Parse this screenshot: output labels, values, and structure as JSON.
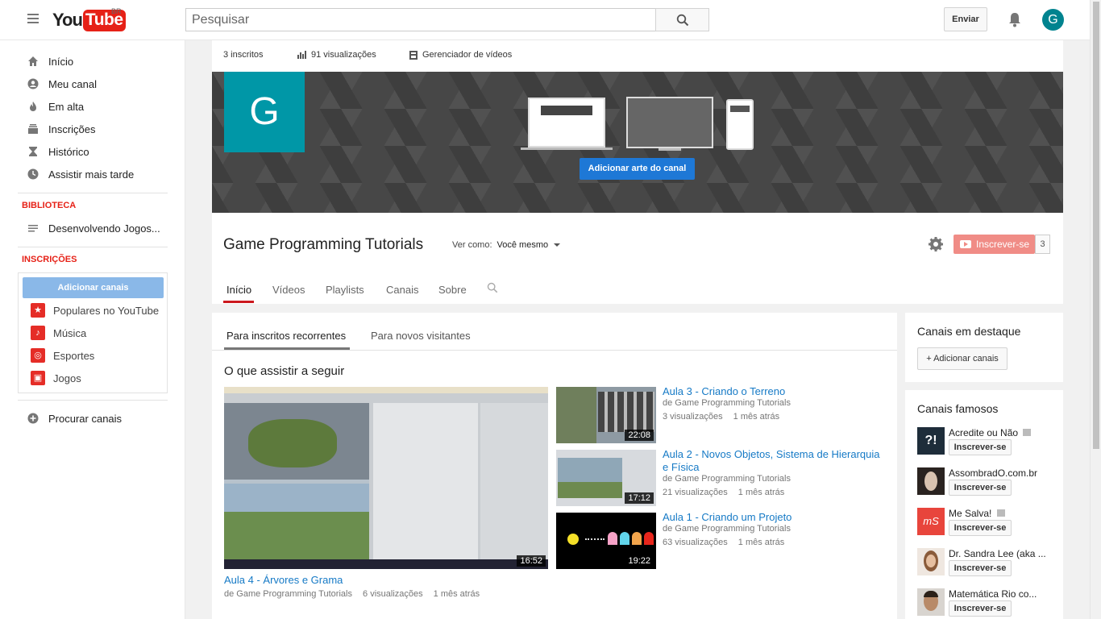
{
  "topbar": {
    "logo_you": "You",
    "logo_tube": "Tube",
    "region": "BR",
    "search_placeholder": "Pesquisar",
    "upload_label": "Enviar",
    "avatar_letter": "G"
  },
  "sidebar": {
    "nav": [
      {
        "label": "Início",
        "icon": "home-icon"
      },
      {
        "label": "Meu canal",
        "icon": "account-icon"
      },
      {
        "label": "Em alta",
        "icon": "flame-icon"
      },
      {
        "label": "Inscrições",
        "icon": "subscriptions-icon"
      },
      {
        "label": "Histórico",
        "icon": "hourglass-icon"
      },
      {
        "label": "Assistir mais tarde",
        "icon": "clock-icon"
      }
    ],
    "library_title": "BIBLIOTECA",
    "library_items": [
      {
        "label": "Desenvolvendo Jogos...",
        "icon": "playlist-icon"
      }
    ],
    "subs_title": "INSCRIÇÕES",
    "add_channels_label": "Adicionar canais",
    "subs": [
      {
        "label": "Populares no YouTube",
        "icon": "star-icon"
      },
      {
        "label": "Música",
        "icon": "music-icon"
      },
      {
        "label": "Esportes",
        "icon": "basketball-icon"
      },
      {
        "label": "Jogos",
        "icon": "gamepad-icon"
      }
    ],
    "browse_label": "Procurar canais"
  },
  "channel": {
    "subscribers": "3 inscritos",
    "views": "91 visualizações",
    "video_manager": "Gerenciador de vídeos",
    "avatar_letter": "G",
    "add_art_label": "Adicionar arte do canal",
    "title": "Game Programming Tutorials",
    "view_as_label": "Ver como:",
    "view_as_value": "Você mesmo",
    "subscribe_label": "Inscrever-se",
    "subscribe_count": "3",
    "tabs": [
      "Início",
      "Vídeos",
      "Playlists",
      "Canais",
      "Sobre"
    ]
  },
  "main": {
    "subtabs": [
      "Para inscritos recorrentes",
      "Para novos visitantes"
    ],
    "section_title": "O que assistir a seguir",
    "featured_video": {
      "title": "Aula 4 - Árvores e Grama",
      "channel": "de Game Programming Tutorials",
      "views": "6 visualizações",
      "ago": "1 mês atrás",
      "duration": "16:52"
    },
    "videos": [
      {
        "title": "Aula 3 - Criando o Terreno",
        "channel": "de Game Programming Tutorials",
        "views": "3 visualizações",
        "ago": "1 mês atrás",
        "duration": "22:08"
      },
      {
        "title": "Aula 2 - Novos Objetos, Sistema de Hierarquia e Física",
        "channel": "de Game Programming Tutorials",
        "views": "21 visualizações",
        "ago": "1 mês atrás",
        "duration": "17:12"
      },
      {
        "title": "Aula 1 - Criando um Projeto",
        "channel": "de Game Programming Tutorials",
        "views": "63 visualizações",
        "ago": "1 mês atrás",
        "duration": "19:22"
      }
    ]
  },
  "right": {
    "featured_title": "Canais em destaque",
    "add_channels_label": "+ Adicionar canais",
    "famous_title": "Canais famosos",
    "subscribe_label": "Inscrever-se",
    "famous": [
      {
        "name": "Acredite ou Não"
      },
      {
        "name": "AssombradO.com.br"
      },
      {
        "name": "Me Salva!"
      },
      {
        "name": "Dr. Sandra Lee (aka ..."
      },
      {
        "name": "Matemática Rio co..."
      }
    ]
  },
  "colors": {
    "brand_red": "#e62117",
    "link_blue": "#167ac6",
    "accent_blue": "#1e78d6",
    "avatar_teal": "#0097a7"
  }
}
